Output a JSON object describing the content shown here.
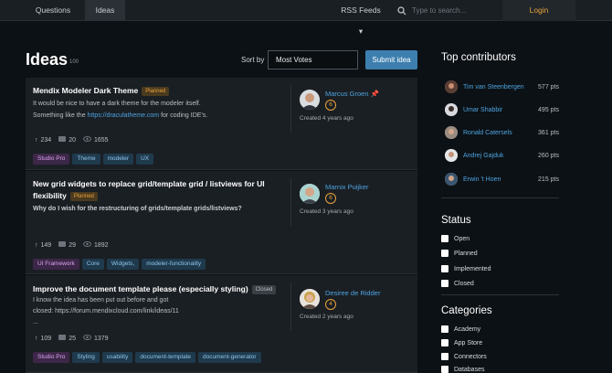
{
  "nav": {
    "tabs": [
      {
        "label": "Questions"
      },
      {
        "label": "Ideas"
      }
    ],
    "rss_label": "RSS Feeds",
    "search_placeholder": "Type to search...",
    "login_label": "Login"
  },
  "header": {
    "title": "Ideas",
    "count": "100",
    "sort_label": "Sort by",
    "sort_value": "Most Votes",
    "submit_label": "Submit idea"
  },
  "ideas": [
    {
      "title": "Mendix Modeler Dark Theme",
      "status": "Planned",
      "desc_line1": "It would be nice to have a dark theme for the modeler itself.",
      "desc_line2_pre": "Something like the ",
      "desc_link": "https://draculatheme.com",
      "desc_line2_post": " for coding IDE's.",
      "votes": "234",
      "comments": "20",
      "views": "1655",
      "tags": [
        "Studio Pro",
        "Theme",
        "modeler",
        "UX"
      ],
      "author": "Marcus Groen",
      "reputation": "6",
      "created": "Created 4 years ago"
    },
    {
      "title_line1": "New grid widgets to replace grid/template grid / listviews for UI",
      "title_line2": "flexibility",
      "status": "Planned",
      "desc_line1": "Why do I wish for the restructuring of grids/template grids/listviews?",
      "votes": "149",
      "comments": "29",
      "views": "1892",
      "tags": [
        "UI Framework",
        "Core",
        "Widgets,",
        "modeler-functionality"
      ],
      "author": "Marnix Puijker",
      "reputation": "6",
      "created": "Created 3 years ago"
    },
    {
      "title": "Improve the document template please (especially styling)",
      "status": "Closed",
      "desc_line1": "I know the idea has been put out before and got",
      "desc_line2": "closed: https://forum.mendixcloud.com/link/ideas/11",
      "desc_line3": "...",
      "votes": "109",
      "comments": "25",
      "views": "1379",
      "tags": [
        "Studio Pro",
        "Styling",
        "usability",
        "document-template",
        "document-generator"
      ],
      "author": "Desiree de Ridder",
      "reputation": "4",
      "created": "Created 2 years ago"
    }
  ],
  "sidebar": {
    "contributors_title": "Top contributors",
    "contributors": [
      {
        "name": "Tim van Steenbergen",
        "pts": "577 pts"
      },
      {
        "name": "Umar Shabbir",
        "pts": "495 pts"
      },
      {
        "name": "Ronald Catersels",
        "pts": "361 pts"
      },
      {
        "name": "Andrej Gajduk",
        "pts": "260 pts"
      },
      {
        "name": "Erwin 't Hoen",
        "pts": "215 pts"
      }
    ],
    "status_title": "Status",
    "status_options": [
      "Open",
      "Planned",
      "Implemented",
      "Closed"
    ],
    "categories_title": "Categories",
    "category_options": [
      "Academy",
      "App Store",
      "Connectors",
      "Databases"
    ]
  },
  "colors": {
    "accent": "#4da3df",
    "login": "#e9a23b",
    "planned": "#e9a23b"
  }
}
